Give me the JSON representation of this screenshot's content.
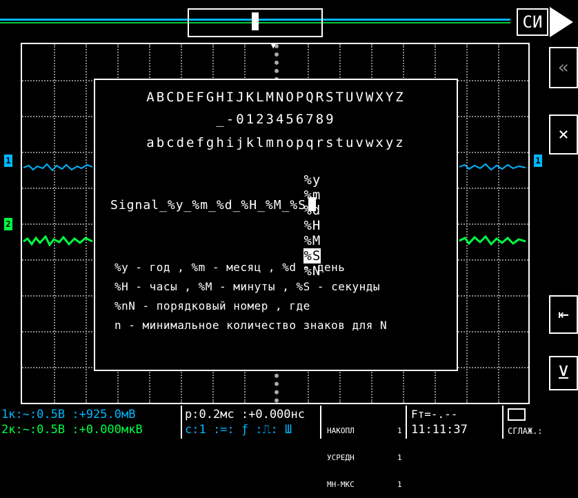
{
  "top": {
    "mode_label": "СИ"
  },
  "dialog": {
    "charset": {
      "upper": "ABCDEFGHIJKLMNOPQRSTUVWXYZ",
      "digits": "_-0123456789",
      "lower": "abcdefghijklmnopqrstuvwxyz",
      "tokens": [
        "%y",
        "%m",
        "%d",
        "%H",
        "%M",
        "%S",
        "%N"
      ],
      "selected_token": "%S"
    },
    "filename": "Signal_%y_%m_%d_%H_%M_%S",
    "help": [
      "%y - год , %m - месяц , %d - день",
      "%H - часы , %M - минуты , %S - секунды",
      "%nN - порядковый номер , где",
      "n - минимальное количество знаков для N"
    ]
  },
  "channels": {
    "ch1": {
      "marker": "1",
      "color": "#00b7ff"
    },
    "ch2": {
      "marker": "2",
      "color": "#00ff44"
    }
  },
  "status": {
    "ch1_line": "1к:~:0.5В :+925.0мВ",
    "ch2_line": "2к:~:0.5В :+0.000мкВ",
    "timebase": "р:0.2мс :+0.000нс",
    "trigger": "с:1 :=: ƒ :⎍: Ш",
    "accum_1": "НАКОПЛ",
    "accum_2": "УСРЕДН",
    "accum_3": "МН-МКС",
    "counts_1": "1",
    "counts_2": "1",
    "counts_3": "1",
    "freq": "Fт=-.--",
    "clock": "11:11:37",
    "memory": "СГЛАЖ.:"
  },
  "right_buttons": {
    "back": "«",
    "close": "×",
    "backspace": "⇤",
    "insert": "⊻"
  }
}
